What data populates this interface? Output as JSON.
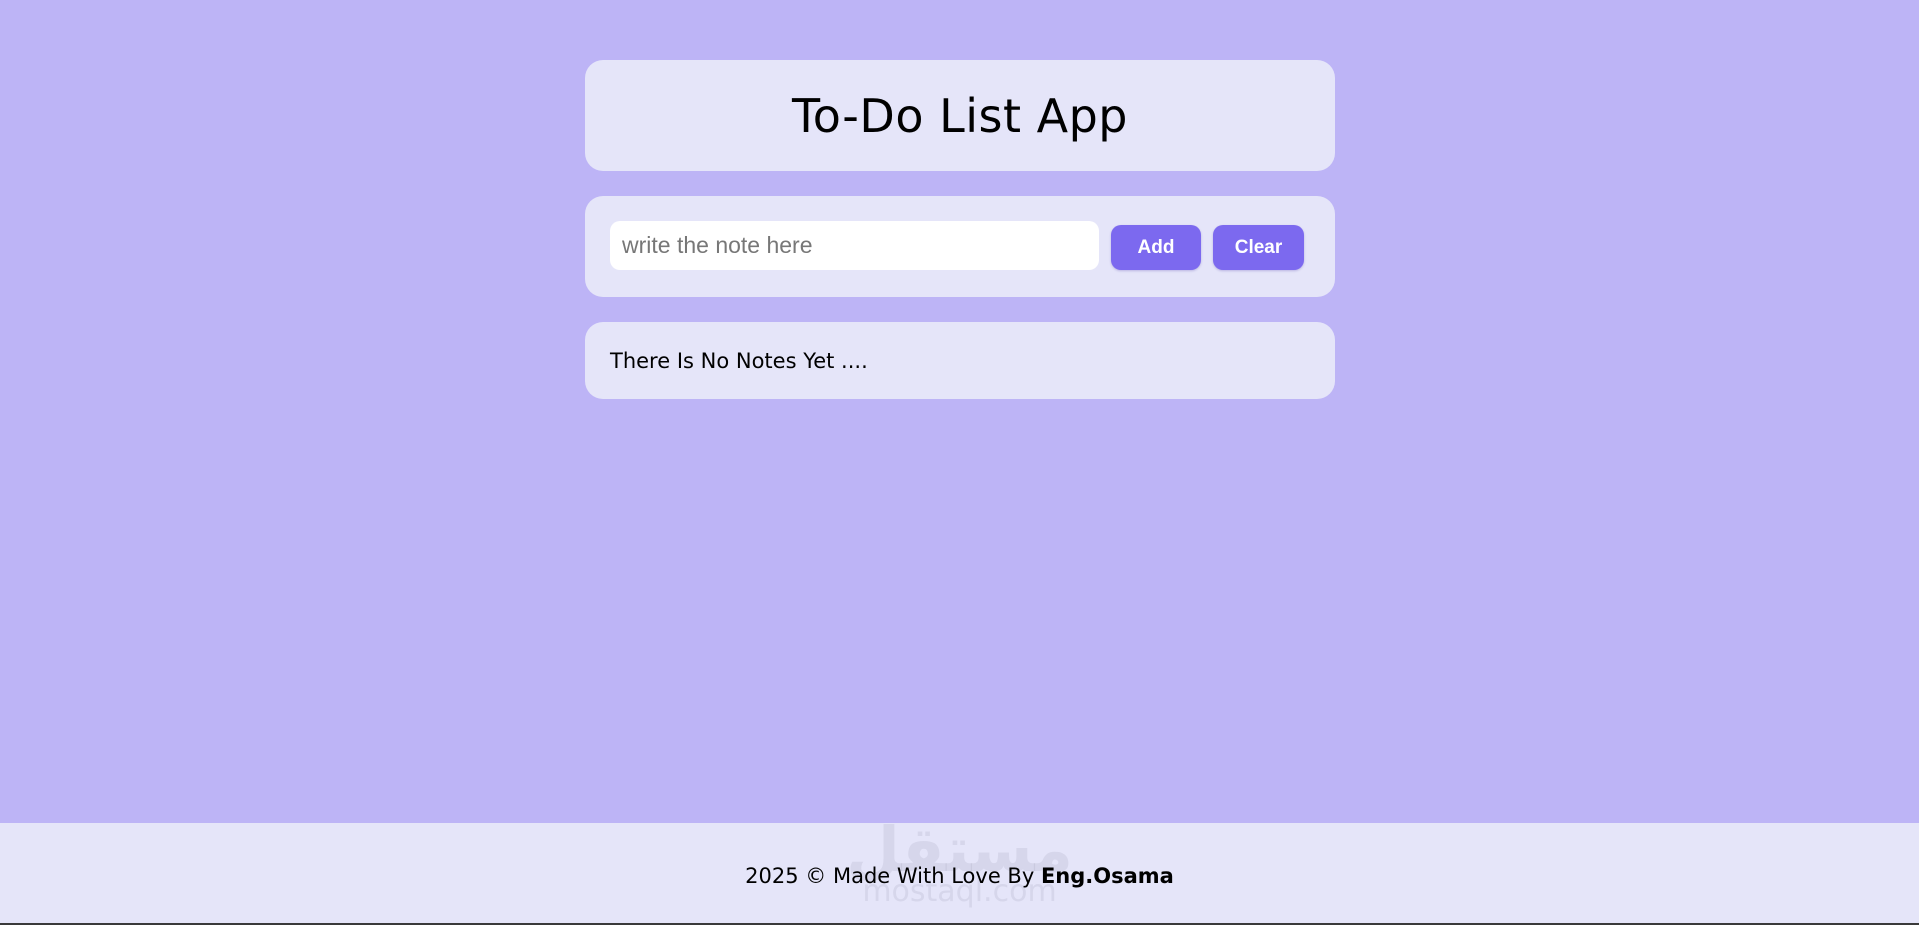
{
  "app": {
    "title": "To-Do List App"
  },
  "note_form": {
    "input_value": "",
    "input_placeholder": "write the note here",
    "add_label": "Add",
    "clear_label": "Clear"
  },
  "notes": {
    "empty_message": "There Is No Notes Yet ...."
  },
  "footer": {
    "text": "2025 © Made With Love By ",
    "author": "Eng.Osama"
  },
  "watermark": {
    "logo_text": "مستقل",
    "url_text": "mostaql.com"
  },
  "colors": {
    "page_background": "#bdb4f6",
    "card_background": "#e5e5f9",
    "button_accent": "#7c69ef"
  }
}
